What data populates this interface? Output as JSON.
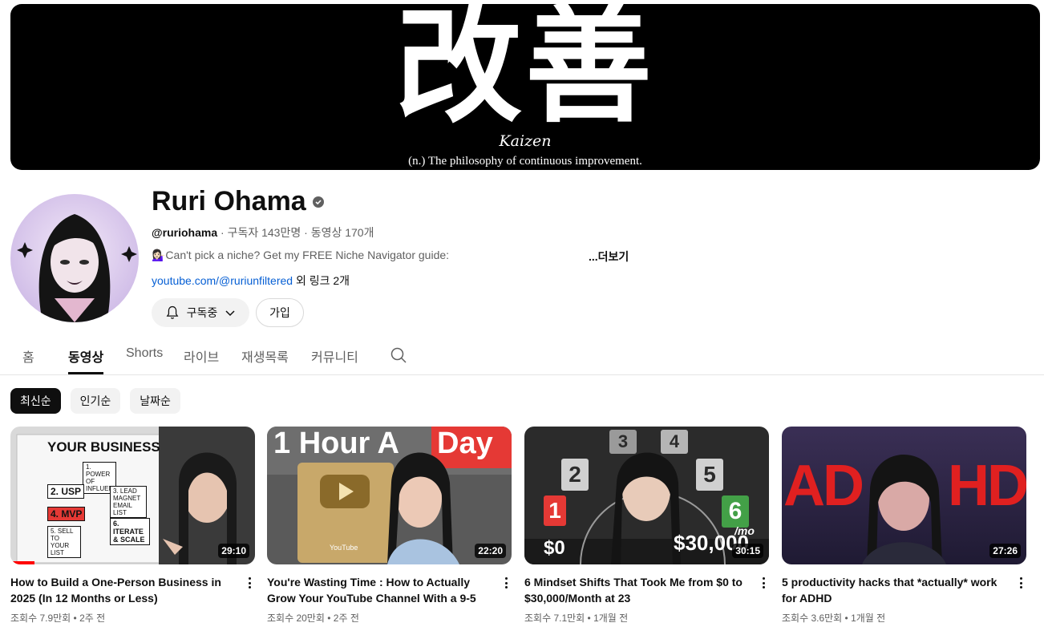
{
  "banner": {
    "kanji": "改善",
    "word": "Kaizen",
    "tagline": "(n.) The philosophy of continuous improvement."
  },
  "channel": {
    "name": "Ruri Ohama",
    "handle": "@ruriohama",
    "subscribers": "구독자 143만명",
    "video_count": "동영상 170개",
    "description": "💁🏻‍♀️Can't pick a niche? Get my FREE Niche Navigator guide:",
    "description_more": "...더보기",
    "link_url": "youtube.com/@ruriunfiltered",
    "link_more": " 외 링크 2개",
    "subscribe_label": "구독중",
    "join_label": "가입"
  },
  "tabs": [
    {
      "label": "홈"
    },
    {
      "label": "동영상"
    },
    {
      "label": "Shorts"
    },
    {
      "label": "라이브"
    },
    {
      "label": "재생목록"
    },
    {
      "label": "커뮤니티"
    }
  ],
  "chips": [
    {
      "label": "최신순"
    },
    {
      "label": "인기순"
    },
    {
      "label": "날짜순"
    }
  ],
  "videos": [
    {
      "title": "How to Build a One-Person Business in 2025 (In 12 Months or Less)",
      "views": "조회수 7.9만회",
      "age": "2주 전",
      "duration": "29:10",
      "thumb_lines": [
        "YOUR BUSINESS",
        "1. POWER OF INFLUENCE",
        "2. USP",
        "3. LEAD MAGNET EMAIL LIST",
        "4. MVP",
        "5. SELL TO YOUR LIST",
        "6. ITERATE & SCALE"
      ]
    },
    {
      "title": "You're Wasting Time : How to Actually Grow Your YouTube Channel With a 9-5",
      "views": "조회수 20만회",
      "age": "2주 전",
      "duration": "22:20",
      "thumb_lines": [
        "1 Hour A",
        "Day",
        "YouTube"
      ]
    },
    {
      "title": "6 Mindset Shifts That Took Me from $0 to $30,000/Month at 23",
      "views": "조회수 7.1만회",
      "age": "1개월 전",
      "duration": "30:15",
      "thumb_lines": [
        "1",
        "2",
        "3",
        "4",
        "5",
        "6",
        "$0",
        "$30,000",
        "/mo"
      ]
    },
    {
      "title": "5 productivity hacks that *actually* work for ADHD",
      "views": "조회수 3.6만회",
      "age": "1개월 전",
      "duration": "27:26",
      "thumb_lines": [
        "AD",
        "HD"
      ]
    }
  ],
  "meta_separator": " • ",
  "colors": {
    "accent_red": "#ff0000",
    "link_blue": "#065fd4",
    "text_primary": "#0f0f0f",
    "text_secondary": "#606060",
    "chip_bg": "#f2f2f2"
  }
}
